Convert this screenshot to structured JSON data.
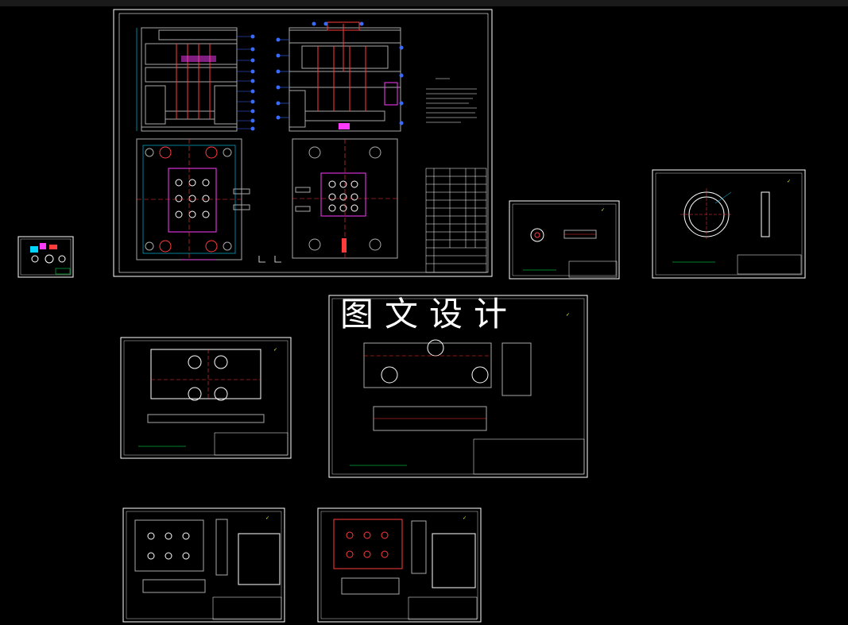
{
  "watermark": {
    "text": "图文设计"
  },
  "colors": {
    "background": "#000000",
    "sheet_border": "#ffffff",
    "mold_plate": "#a9a9a9",
    "cavity": "#ff3b3b",
    "dimension": "#00d5ff",
    "part": "#ff3bff",
    "balloon": "#3a6bff",
    "table_line": "#ffffff",
    "note_text": "#00ff55",
    "title_cell": "#00ff55",
    "roughness_mark": "#ffff00"
  },
  "drawings": [
    {
      "id": "mold-assembly",
      "kind": "assembly"
    },
    {
      "id": "small-parts-sheet",
      "kind": "thumbnail"
    },
    {
      "id": "small-insert-sheet",
      "kind": "part"
    },
    {
      "id": "ring-part-sheet",
      "kind": "part"
    },
    {
      "id": "plate-sheet",
      "kind": "part"
    },
    {
      "id": "core-plate-sheet",
      "kind": "part"
    },
    {
      "id": "cavity-plate-sheet-a",
      "kind": "part"
    },
    {
      "id": "cavity-plate-sheet-b",
      "kind": "part"
    }
  ]
}
